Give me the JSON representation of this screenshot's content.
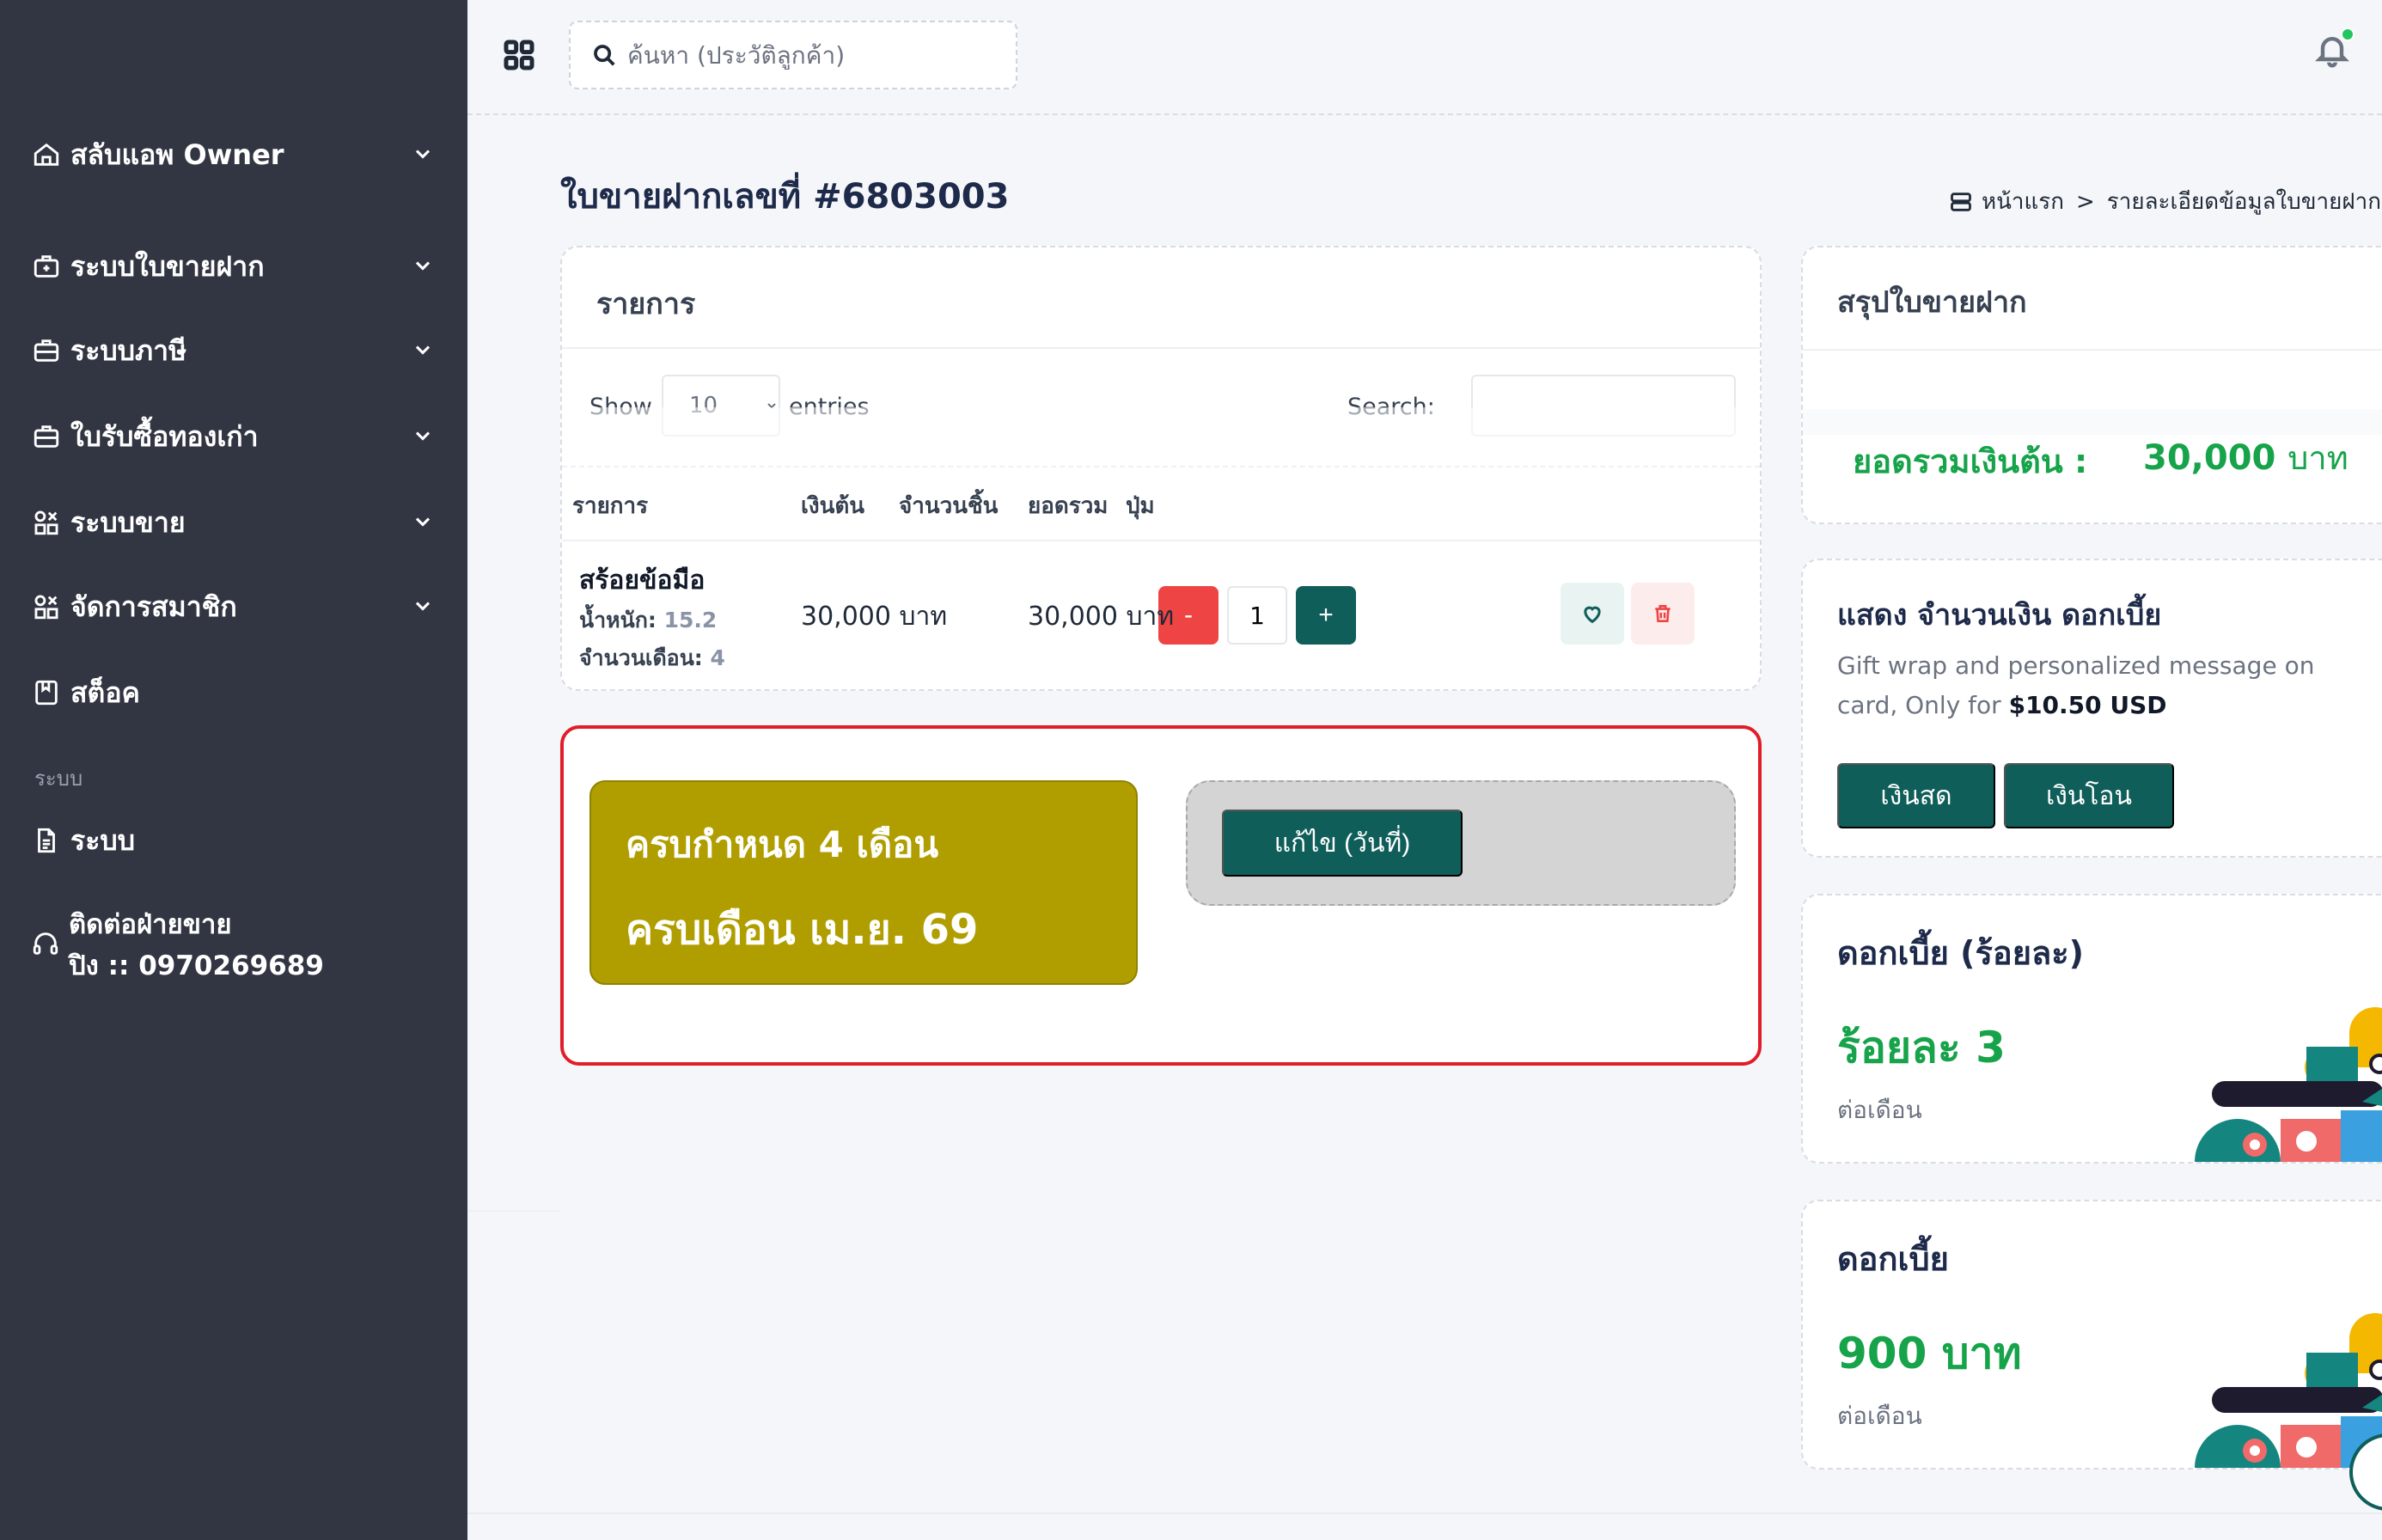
{
  "sidebar": {
    "items": [
      {
        "label": "สลับแอพ Owner",
        "icon": "home-icon"
      },
      {
        "label": "ระบบใบขายฝาก",
        "icon": "medical-bag-icon"
      },
      {
        "label": "ระบบภาษี",
        "icon": "briefcase-icon"
      },
      {
        "label": "ใบรับซื้อทองเก่า",
        "icon": "briefcase-icon"
      },
      {
        "label": "ระบบขาย",
        "icon": "shapes-icon"
      },
      {
        "label": "จัดการสมาชิก",
        "icon": "shapes-icon"
      },
      {
        "label": "สต็อค",
        "icon": "bookmark-icon"
      }
    ],
    "section_label": "ระบบ",
    "system_item": {
      "label": "ระบบ",
      "icon": "document-icon"
    },
    "contact": {
      "line1": "ติดต่อฝ่ายขาย",
      "line2": "ปิง :: 0970269689",
      "icon": "headset-icon"
    }
  },
  "topbar": {
    "search_placeholder": "ค้นหา (ประวัติลูกค้า)"
  },
  "page": {
    "title": "ใบขายฝากเลขที่ #6803003",
    "breadcrumb_home": "หน้าแรก",
    "breadcrumb_sep": ">",
    "breadcrumb_current": "รายละเอียดข้อมูลใบขายฝาก"
  },
  "items_card": {
    "title": "รายการ",
    "show_label": "Show",
    "entries_value": "10",
    "entries_label": "entries",
    "search_label": "Search:",
    "columns": [
      "รายการ",
      "เงินต้น",
      "จำนวนชิ้น",
      "ยอดรวม",
      "ปุ่ม"
    ],
    "row": {
      "name": "สร้อยข้อมือ",
      "weight_label": "น้ำหนัก:",
      "weight_value": "15.2",
      "months_label": "จำนวนเดือน:",
      "months_value": "4",
      "principal": "30,000 บาท",
      "qty": "1",
      "minus": "-",
      "plus": "+",
      "total": "30,000 บาท"
    }
  },
  "due_box": {
    "line1": "ครบกำหนด 4 เดือน",
    "line2": "ครบเดือน เม.ย. 69",
    "edit_label": "แก้ไข (วันที่)"
  },
  "summary": {
    "title": "สรุปใบขายฝาก",
    "total_label": "ยอดรวมเงินต้น :",
    "total_value": "30,000",
    "total_unit": "บาท"
  },
  "interest_card": {
    "title": "แสดง จำนวนเงิน ดอกเบี้ย",
    "desc": "Gift wrap and personalized message on card, Only for",
    "price": "$10.50 USD",
    "cash_label": "เงินสด",
    "transfer_label": "เงินโอน"
  },
  "rate_card": {
    "title": "ดอกเบี้ย (ร้อยละ)",
    "value": "ร้อยละ 3",
    "sub": "ต่อเดือน"
  },
  "amount_card": {
    "title": "ดอกเบี้ย",
    "value": "900 บาท",
    "sub": "ต่อเดือน"
  },
  "colors": {
    "sidebar_bg": "#323643",
    "primary": "#0f5e5a",
    "danger": "#ef4444",
    "success": "#16a34a",
    "due_box": "#b09e00",
    "highlight_border": "#e11d2a"
  }
}
